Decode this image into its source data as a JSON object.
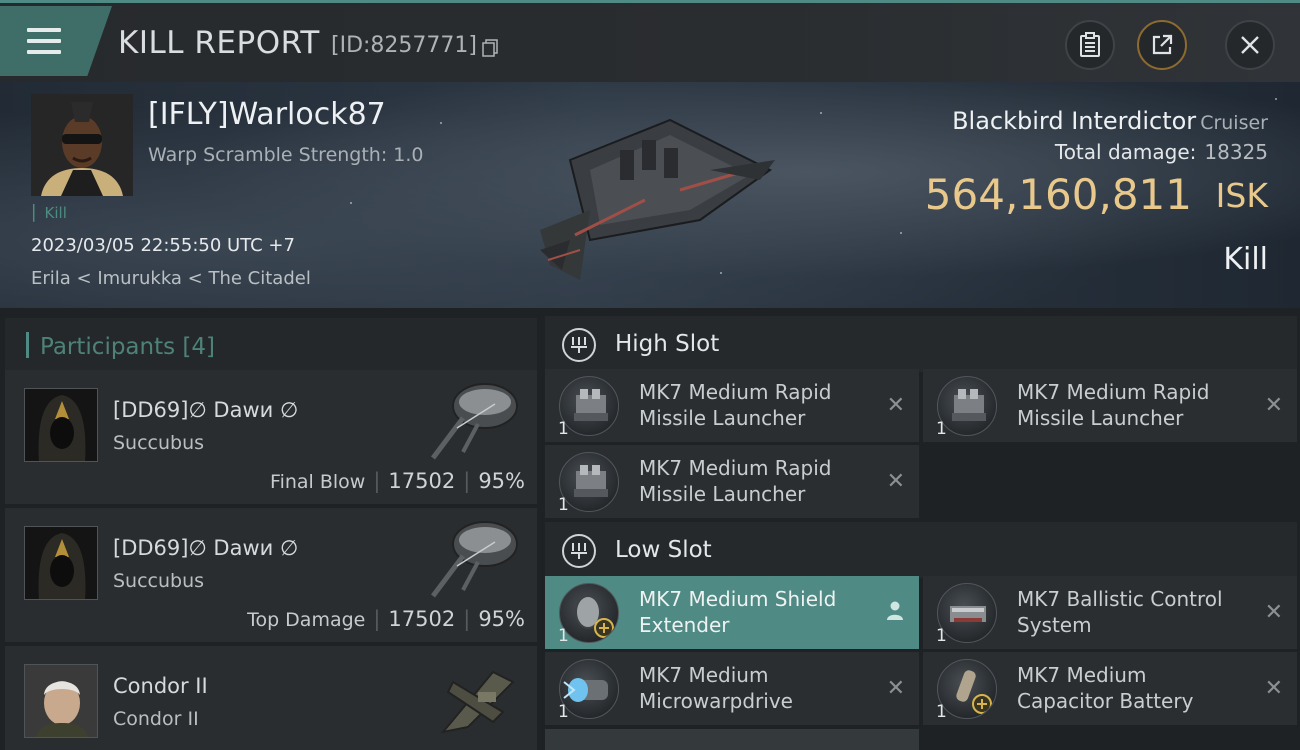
{
  "header": {
    "title": "KILL REPORT",
    "report_id": "[ID:8257771]"
  },
  "victim": {
    "pilot_name": "[IFLY]Warlock87",
    "stat_line": "Warp Scramble Strength: 1.0",
    "tag": "Kill",
    "timestamp": "2023/03/05 22:55:50 UTC +7",
    "location": "Erila < Imurukka < The Citadel",
    "ship_name": "Blackbird Interdictor",
    "ship_class": "Cruiser",
    "total_damage_label": "Total damage:",
    "total_damage": "18325",
    "isk_value": "564,160,811",
    "isk_unit": "ISK",
    "result": "Kill"
  },
  "participants": {
    "title": "Participants",
    "count": "[4]",
    "items": [
      {
        "name": "[DD69]∅ Dawи ∅",
        "ship": "Succubus",
        "role": "Final Blow",
        "damage": "17502",
        "percent": "95%"
      },
      {
        "name": "[DD69]∅ Dawи ∅",
        "ship": "Succubus",
        "role": "Top Damage",
        "damage": "17502",
        "percent": "95%"
      },
      {
        "name": "Condor II",
        "ship": "Condor II"
      }
    ]
  },
  "fitting": {
    "high_slot": {
      "label": "High Slot",
      "modules": [
        {
          "qty": "1",
          "name": "MK7 Medium Rapid Missile Launcher"
        },
        {
          "qty": "1",
          "name": "MK7 Medium Rapid Missile Launcher"
        },
        {
          "qty": "1",
          "name": "MK7 Medium Rapid Missile Launcher"
        }
      ]
    },
    "low_slot": {
      "label": "Low Slot",
      "modules": [
        {
          "qty": "1",
          "name": "MK7 Medium Shield Extender"
        },
        {
          "qty": "1",
          "name": "MK7 Ballistic Control System"
        },
        {
          "qty": "1",
          "name": "MK7 Medium Microwarpdrive"
        },
        {
          "qty": "1",
          "name": "MK7 Medium Capacitor Battery"
        }
      ]
    }
  },
  "colors": {
    "accent_teal": "#4f8a84",
    "isk_gold": "#e8c98b",
    "background": "#1c1f22"
  },
  "icons": {
    "menu": "hamburger-icon",
    "copy": "copy-icon",
    "clipboard": "clipboard-icon",
    "share": "share-icon",
    "close": "close-icon",
    "slot": "slot-shield-icon",
    "remove": "x-icon",
    "pilot": "person-icon"
  }
}
